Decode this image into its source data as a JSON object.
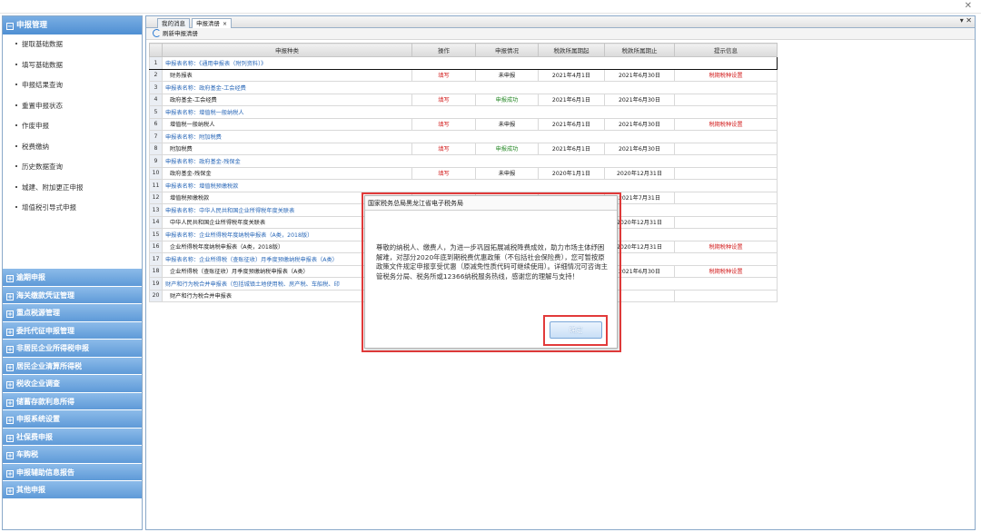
{
  "sidebar": {
    "header": "申报管理",
    "items": [
      "提取基础数据",
      "填写基础数据",
      "申报结果查询",
      "重置申报状态",
      "作废申报",
      "税费缴纳",
      "历史数据查询",
      "城建、附加更正申报",
      "增值税引导式申报"
    ],
    "groups": [
      "逾期申报",
      "海关缴款凭证管理",
      "重点税源管理",
      "委托代征申报管理",
      "非居民企业所得税申报",
      "居民企业清算所得税",
      "税收企业调查",
      "储蓄存款利息所得",
      "申报系统设置",
      "社保费申报",
      "车购税",
      "申报辅助信息报告",
      "其他申报"
    ]
  },
  "tabs": [
    {
      "label": "我的消息"
    },
    {
      "label": "申报清册",
      "close": "×"
    }
  ],
  "toolbar": {
    "refresh_label": "刷新申报清册"
  },
  "chart_data": {
    "type": "table",
    "columns": [
      "",
      "申报种类",
      "操作",
      "申报情况",
      "税款所属期起",
      "税款所属期止",
      "提示信息"
    ],
    "rows": [
      {
        "no": "1",
        "kind": "申报表名称：《通用申报表（附列资料）》",
        "section": true
      },
      {
        "no": "2",
        "kind": "财务报表",
        "op": "填写",
        "status": "未申报",
        "start": "2021年4月1日",
        "end": "2021年6月30日",
        "tip": "税期税种设置"
      },
      {
        "no": "3",
        "kind": "申报表名称：政府基金-工会经费",
        "section": true
      },
      {
        "no": "4",
        "kind": "政府基金-工会经费",
        "op": "填写",
        "status": "申报成功",
        "start": "2021年6月1日",
        "end": "2021年6月30日",
        "tip": ""
      },
      {
        "no": "5",
        "kind": "申报表名称：增值税一般纳税人",
        "section": true
      },
      {
        "no": "6",
        "kind": "增值税一般纳税人",
        "op": "填写",
        "status": "未申报",
        "start": "2021年6月1日",
        "end": "2021年6月30日",
        "tip": "税期税种设置"
      },
      {
        "no": "7",
        "kind": "申报表名称：附加税费",
        "section": true
      },
      {
        "no": "8",
        "kind": "附加税费",
        "op": "填写",
        "status": "申报成功",
        "start": "2021年6月1日",
        "end": "2021年6月30日",
        "tip": ""
      },
      {
        "no": "9",
        "kind": "申报表名称：政府基金-残保金",
        "section": true
      },
      {
        "no": "10",
        "kind": "政府基金-残保金",
        "op": "填写",
        "status": "未申报",
        "start": "2020年1月1日",
        "end": "2020年12月31日",
        "tip": ""
      },
      {
        "no": "11",
        "kind": "申报表名称：增值税预缴税款",
        "section": true
      },
      {
        "no": "12",
        "kind": "增值税预缴税款",
        "op": "",
        "status": "",
        "start": "",
        "end": "2021年7月31日",
        "tip": ""
      },
      {
        "no": "13",
        "kind": "申报表名称：中华人民共和国企业所得税年度关联表",
        "section": true
      },
      {
        "no": "14",
        "kind": "中华人民共和国企业所得税年度关联表",
        "op": "",
        "status": "",
        "start": "",
        "end": "2020年12月31日",
        "tip": ""
      },
      {
        "no": "15",
        "kind": "申报表名称：企业所得税年度纳税申报表（A类，2018版）",
        "section": true
      },
      {
        "no": "16",
        "kind": "企业所得税年度纳税申报表（A类，2018版）",
        "op": "",
        "status": "",
        "start": "",
        "end": "2020年12月31日",
        "tip": "税期税种设置"
      },
      {
        "no": "17",
        "kind": "申报表名称：企业所得税（查账征收）月季度预缴纳税申报表（A类）",
        "section": true
      },
      {
        "no": "18",
        "kind": "企业所得税（查账征收）月季度预缴纳税申报表（A类）",
        "op": "",
        "status": "",
        "start": "",
        "end": "2021年6月30日",
        "tip": "税期税种设置"
      },
      {
        "no": "19",
        "kind": "财产和行为税合并申报表（包括城镇土地使用税、房产税、车船税、印",
        "section": true
      },
      {
        "no": "20",
        "kind": "财产和行为税合并申报表",
        "op": "",
        "status": "",
        "start": "",
        "end": "",
        "tip": ""
      }
    ]
  },
  "dialog": {
    "title": "国家税务总局黑龙江省电子税务局",
    "message": "尊敬的纳税人、缴费人，为进一步巩固拓展减税降费成效，助力市场主体纾困解难，对部分2020年底到期税费优惠政策（不包括社会保险费），您可暂按原政策文件规定申报享受优惠（原减免性质代码可继续使用）。详细情况可咨询主管税务分局、税务所或12366纳税服务热线，感谢您的理解与支持！",
    "ok_label": "确定"
  },
  "colors": {
    "accent": "#4f8fd3",
    "highlight": "#e23a3a",
    "link": "#2a68b8",
    "action": "#d21c1c",
    "success": "#2a8a2a"
  }
}
